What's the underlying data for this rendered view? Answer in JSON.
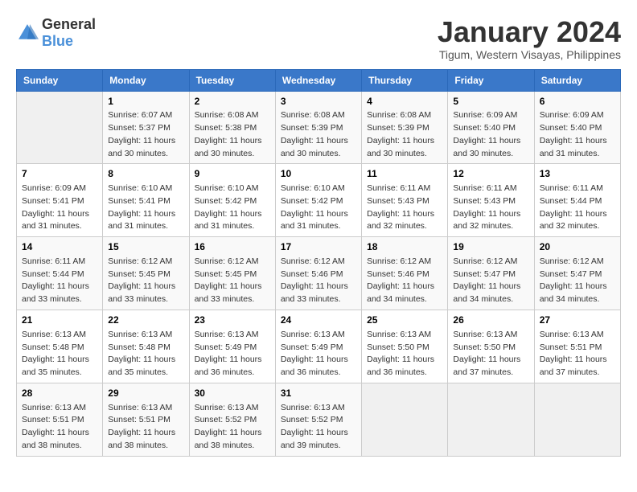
{
  "logo": {
    "text_general": "General",
    "text_blue": "Blue"
  },
  "title": "January 2024",
  "subtitle": "Tigum, Western Visayas, Philippines",
  "days_header": [
    "Sunday",
    "Monday",
    "Tuesday",
    "Wednesday",
    "Thursday",
    "Friday",
    "Saturday"
  ],
  "weeks": [
    [
      {
        "day": "",
        "sunrise": "",
        "sunset": "",
        "daylight": ""
      },
      {
        "day": "1",
        "sunrise": "Sunrise: 6:07 AM",
        "sunset": "Sunset: 5:37 PM",
        "daylight": "Daylight: 11 hours and 30 minutes."
      },
      {
        "day": "2",
        "sunrise": "Sunrise: 6:08 AM",
        "sunset": "Sunset: 5:38 PM",
        "daylight": "Daylight: 11 hours and 30 minutes."
      },
      {
        "day": "3",
        "sunrise": "Sunrise: 6:08 AM",
        "sunset": "Sunset: 5:39 PM",
        "daylight": "Daylight: 11 hours and 30 minutes."
      },
      {
        "day": "4",
        "sunrise": "Sunrise: 6:08 AM",
        "sunset": "Sunset: 5:39 PM",
        "daylight": "Daylight: 11 hours and 30 minutes."
      },
      {
        "day": "5",
        "sunrise": "Sunrise: 6:09 AM",
        "sunset": "Sunset: 5:40 PM",
        "daylight": "Daylight: 11 hours and 30 minutes."
      },
      {
        "day": "6",
        "sunrise": "Sunrise: 6:09 AM",
        "sunset": "Sunset: 5:40 PM",
        "daylight": "Daylight: 11 hours and 31 minutes."
      }
    ],
    [
      {
        "day": "7",
        "sunrise": "Sunrise: 6:09 AM",
        "sunset": "Sunset: 5:41 PM",
        "daylight": "Daylight: 11 hours and 31 minutes."
      },
      {
        "day": "8",
        "sunrise": "Sunrise: 6:10 AM",
        "sunset": "Sunset: 5:41 PM",
        "daylight": "Daylight: 11 hours and 31 minutes."
      },
      {
        "day": "9",
        "sunrise": "Sunrise: 6:10 AM",
        "sunset": "Sunset: 5:42 PM",
        "daylight": "Daylight: 11 hours and 31 minutes."
      },
      {
        "day": "10",
        "sunrise": "Sunrise: 6:10 AM",
        "sunset": "Sunset: 5:42 PM",
        "daylight": "Daylight: 11 hours and 31 minutes."
      },
      {
        "day": "11",
        "sunrise": "Sunrise: 6:11 AM",
        "sunset": "Sunset: 5:43 PM",
        "daylight": "Daylight: 11 hours and 32 minutes."
      },
      {
        "day": "12",
        "sunrise": "Sunrise: 6:11 AM",
        "sunset": "Sunset: 5:43 PM",
        "daylight": "Daylight: 11 hours and 32 minutes."
      },
      {
        "day": "13",
        "sunrise": "Sunrise: 6:11 AM",
        "sunset": "Sunset: 5:44 PM",
        "daylight": "Daylight: 11 hours and 32 minutes."
      }
    ],
    [
      {
        "day": "14",
        "sunrise": "Sunrise: 6:11 AM",
        "sunset": "Sunset: 5:44 PM",
        "daylight": "Daylight: 11 hours and 33 minutes."
      },
      {
        "day": "15",
        "sunrise": "Sunrise: 6:12 AM",
        "sunset": "Sunset: 5:45 PM",
        "daylight": "Daylight: 11 hours and 33 minutes."
      },
      {
        "day": "16",
        "sunrise": "Sunrise: 6:12 AM",
        "sunset": "Sunset: 5:45 PM",
        "daylight": "Daylight: 11 hours and 33 minutes."
      },
      {
        "day": "17",
        "sunrise": "Sunrise: 6:12 AM",
        "sunset": "Sunset: 5:46 PM",
        "daylight": "Daylight: 11 hours and 33 minutes."
      },
      {
        "day": "18",
        "sunrise": "Sunrise: 6:12 AM",
        "sunset": "Sunset: 5:46 PM",
        "daylight": "Daylight: 11 hours and 34 minutes."
      },
      {
        "day": "19",
        "sunrise": "Sunrise: 6:12 AM",
        "sunset": "Sunset: 5:47 PM",
        "daylight": "Daylight: 11 hours and 34 minutes."
      },
      {
        "day": "20",
        "sunrise": "Sunrise: 6:12 AM",
        "sunset": "Sunset: 5:47 PM",
        "daylight": "Daylight: 11 hours and 34 minutes."
      }
    ],
    [
      {
        "day": "21",
        "sunrise": "Sunrise: 6:13 AM",
        "sunset": "Sunset: 5:48 PM",
        "daylight": "Daylight: 11 hours and 35 minutes."
      },
      {
        "day": "22",
        "sunrise": "Sunrise: 6:13 AM",
        "sunset": "Sunset: 5:48 PM",
        "daylight": "Daylight: 11 hours and 35 minutes."
      },
      {
        "day": "23",
        "sunrise": "Sunrise: 6:13 AM",
        "sunset": "Sunset: 5:49 PM",
        "daylight": "Daylight: 11 hours and 36 minutes."
      },
      {
        "day": "24",
        "sunrise": "Sunrise: 6:13 AM",
        "sunset": "Sunset: 5:49 PM",
        "daylight": "Daylight: 11 hours and 36 minutes."
      },
      {
        "day": "25",
        "sunrise": "Sunrise: 6:13 AM",
        "sunset": "Sunset: 5:50 PM",
        "daylight": "Daylight: 11 hours and 36 minutes."
      },
      {
        "day": "26",
        "sunrise": "Sunrise: 6:13 AM",
        "sunset": "Sunset: 5:50 PM",
        "daylight": "Daylight: 11 hours and 37 minutes."
      },
      {
        "day": "27",
        "sunrise": "Sunrise: 6:13 AM",
        "sunset": "Sunset: 5:51 PM",
        "daylight": "Daylight: 11 hours and 37 minutes."
      }
    ],
    [
      {
        "day": "28",
        "sunrise": "Sunrise: 6:13 AM",
        "sunset": "Sunset: 5:51 PM",
        "daylight": "Daylight: 11 hours and 38 minutes."
      },
      {
        "day": "29",
        "sunrise": "Sunrise: 6:13 AM",
        "sunset": "Sunset: 5:51 PM",
        "daylight": "Daylight: 11 hours and 38 minutes."
      },
      {
        "day": "30",
        "sunrise": "Sunrise: 6:13 AM",
        "sunset": "Sunset: 5:52 PM",
        "daylight": "Daylight: 11 hours and 38 minutes."
      },
      {
        "day": "31",
        "sunrise": "Sunrise: 6:13 AM",
        "sunset": "Sunset: 5:52 PM",
        "daylight": "Daylight: 11 hours and 39 minutes."
      },
      {
        "day": "",
        "sunrise": "",
        "sunset": "",
        "daylight": ""
      },
      {
        "day": "",
        "sunrise": "",
        "sunset": "",
        "daylight": ""
      },
      {
        "day": "",
        "sunrise": "",
        "sunset": "",
        "daylight": ""
      }
    ]
  ]
}
